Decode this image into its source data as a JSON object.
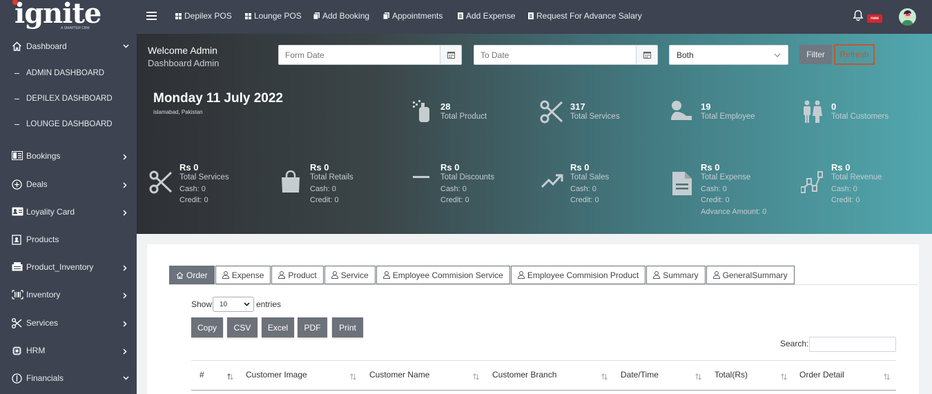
{
  "brand": {
    "name": "ignite",
    "tagline": "A SMARTER CRM"
  },
  "topnav": [
    {
      "label": "Depilex POS",
      "icon": "grid-icon"
    },
    {
      "label": "Lounge POS",
      "icon": "grid-icon"
    },
    {
      "label": "Add Booking",
      "icon": "copy-icon"
    },
    {
      "label": "Appointments",
      "icon": "copy-icon"
    },
    {
      "label": "Add Expense",
      "icon": "doc-icon"
    },
    {
      "label": "Request For Advance Salary",
      "icon": "doc-icon"
    }
  ],
  "notifications": {
    "badge": "new"
  },
  "sidebar": {
    "dashboard": "Dashboard",
    "subitems": [
      "ADMIN DASHBOARD",
      "DEPILEX DASHBOARD",
      "LOUNGE DASHBOARD"
    ],
    "items": [
      "Bookings",
      "Deals",
      "Loyality Card",
      "Products",
      "Product_Inventory",
      "Inventory",
      "Services",
      "HRM",
      "Financials"
    ]
  },
  "header": {
    "welcome": "Welcome Admin",
    "subtitle": "Dashboard Admin",
    "from_date_placeholder": "Form Date",
    "to_date_placeholder": "To Date",
    "branch_select": "Both",
    "filter_label": "Filter",
    "refresh_label": "Refresh"
  },
  "today": {
    "date": "Monday 11 July 2022",
    "location": "islamabad, Pakistan"
  },
  "stats_top": [
    {
      "value": "28",
      "label": "Total Product",
      "icon": "spray-bottle-icon"
    },
    {
      "value": "317",
      "label": "Total Services",
      "icon": "scissors-icon"
    },
    {
      "value": "19",
      "label": "Total Employee",
      "icon": "user-icon"
    },
    {
      "value": "0",
      "label": "Total Customers",
      "icon": "people-icon"
    }
  ],
  "stats_bottom": [
    {
      "value": "Rs 0",
      "label": "Total Services",
      "cash": "Cash: 0",
      "credit": "Credit: 0",
      "icon": "scissors-icon"
    },
    {
      "value": "Rs 0",
      "label": "Total Retails",
      "cash": "Cash: 0",
      "credit": "Credit: 0",
      "icon": "shopping-bag-icon"
    },
    {
      "value": "Rs 0",
      "label": "Total Discounts",
      "cash": "Cash: 0",
      "credit": "Credit: 0",
      "icon": "minus-icon"
    },
    {
      "value": "Rs 0",
      "label": "Total Sales",
      "cash": "Cash: 0",
      "credit": "Credit: 0",
      "icon": "trending-up-icon"
    },
    {
      "value": "Rs 0",
      "label": "Total Expense",
      "cash": "Cash: 0",
      "credit": "Credit: 0",
      "extra": "Advance Amount: 0",
      "icon": "document-icon"
    },
    {
      "value": "Rs 0",
      "label": "Total Revenue",
      "cash": "Cash: 0",
      "credit": "Credit: 0",
      "icon": "chart-nodes-icon"
    }
  ],
  "tabs": [
    "Order",
    "Expense",
    "Product",
    "Service",
    "Employee Commision Service",
    "Employee Commision Product",
    "Summary",
    "GeneralSummary"
  ],
  "table": {
    "show_label": "Show",
    "page_length": "10",
    "entries_label": "entries",
    "export_buttons": [
      "Copy",
      "CSV",
      "Excel",
      "PDF",
      "Print"
    ],
    "search_label": "Search:",
    "columns": [
      "#",
      "Customer Image",
      "Customer Name",
      "Customer Branch",
      "Date/Time",
      "Total(Rs)",
      "Order Detail"
    ]
  }
}
